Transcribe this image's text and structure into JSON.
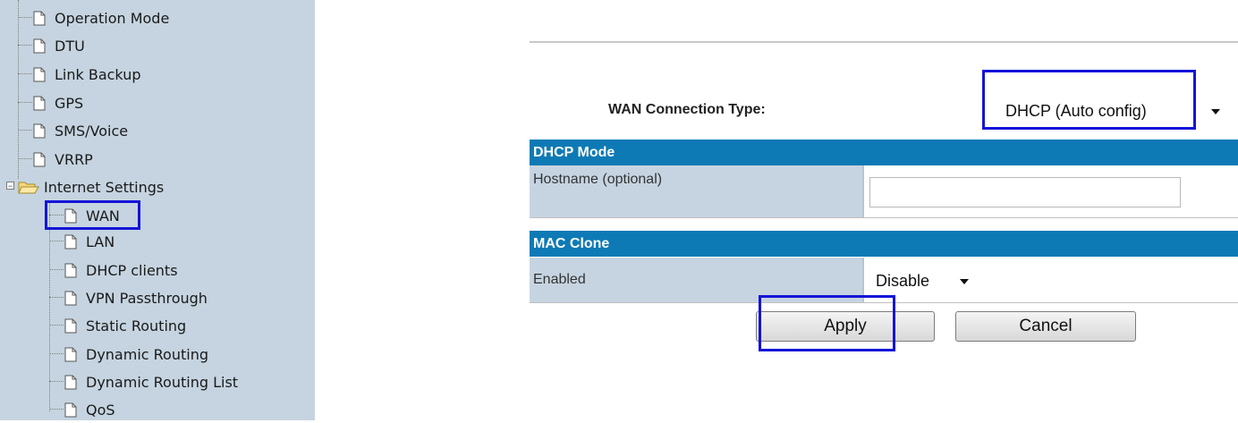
{
  "sidebar": {
    "items": [
      {
        "label": "Operation Mode"
      },
      {
        "label": "DTU"
      },
      {
        "label": "Link Backup"
      },
      {
        "label": "GPS"
      },
      {
        "label": "SMS/Voice"
      },
      {
        "label": "VRRP"
      },
      {
        "label": "Internet Settings"
      },
      {
        "label": "WAN"
      },
      {
        "label": "LAN"
      },
      {
        "label": "DHCP clients"
      },
      {
        "label": "VPN Passthrough"
      },
      {
        "label": "Static Routing"
      },
      {
        "label": "Dynamic Routing"
      },
      {
        "label": "Dynamic Routing List"
      },
      {
        "label": "QoS"
      }
    ],
    "selected": "WAN"
  },
  "main": {
    "wan_type_label": "WAN Connection Type:",
    "wan_type_value": "DHCP (Auto config)",
    "dhcp_section": "DHCP Mode",
    "hostname_label": "Hostname (optional)",
    "hostname_value": "",
    "mac_section": "MAC Clone",
    "enabled_label": "Enabled",
    "enabled_value": "Disable",
    "apply_label": "Apply",
    "cancel_label": "Cancel"
  },
  "colors": {
    "sidebar_bg": "#c5d4e0",
    "section_header_bg": "#0e7ab5",
    "highlight": "#1414d8"
  }
}
